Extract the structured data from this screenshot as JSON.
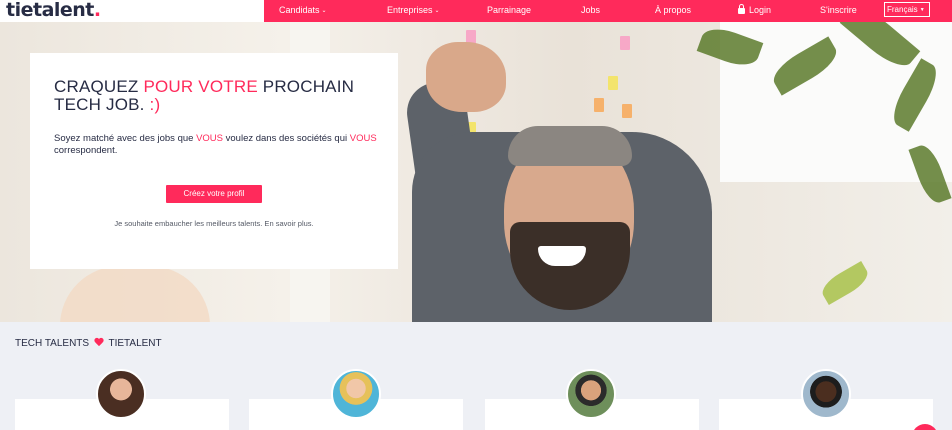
{
  "header": {
    "logo_main": "tietalent",
    "logo_dot": ".",
    "nav": {
      "candidats": "Candidats",
      "entreprises": "Entreprises",
      "parrainage": "Parrainage",
      "jobs": "Jobs",
      "apropos": "À propos",
      "login": "Login",
      "inscrire": "S'inscrire"
    },
    "language": "Français"
  },
  "hero": {
    "title_part1": "CRAQUEZ ",
    "title_accent": "POUR VOTRE",
    "title_part2": " PROCHAIN TECH JOB. ",
    "title_smiley": ":)",
    "subtitle_part1": "Soyez matché avec des jobs que ",
    "subtitle_accent1": "VOUS",
    "subtitle_part2": " voulez dans des sociétés qui ",
    "subtitle_accent2": "VOUS",
    "subtitle_part3": " correspondent.",
    "cta_label": "Créez votre profil",
    "employer_text": "Je souhaite embaucher les meilleurs talents. En savoir plus."
  },
  "talents": {
    "title_left": "TECH TALENTS",
    "title_right": "TIETALENT"
  },
  "colors": {
    "accent": "#ff2a5b",
    "navy": "#272c44"
  }
}
